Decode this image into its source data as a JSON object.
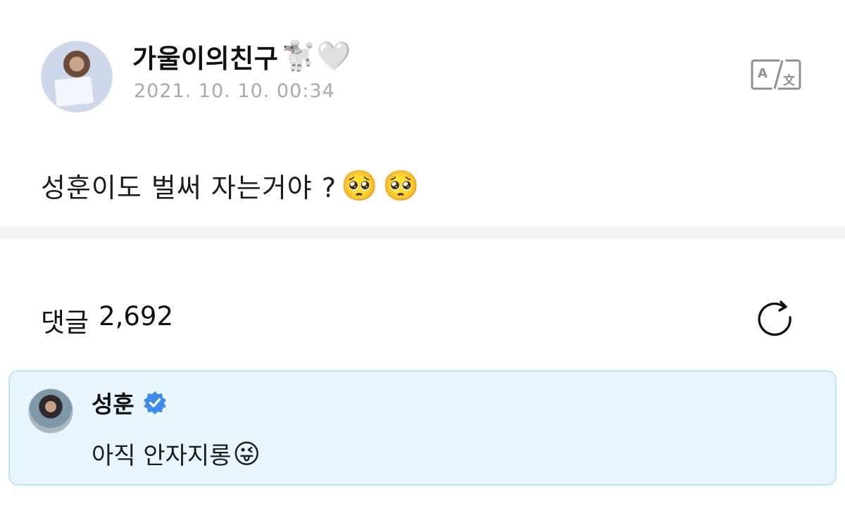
{
  "post": {
    "author_name": "가울이의친구",
    "author_emojis": "🐩🤍",
    "timestamp": "2021. 10. 10. 00:34",
    "body_text": "성훈이도 벌써 자는거야 ?",
    "body_emojis": [
      "🥺",
      "🥺"
    ],
    "translate_icon": "translate-icon"
  },
  "comments": {
    "label": "댓글",
    "count": "2,692",
    "refresh_icon": "refresh-icon"
  },
  "highlighted_comment": {
    "author": "성훈",
    "verified_icon": "verified-badge-icon",
    "text": "아직 안자지롱",
    "emoji": "😜",
    "colors": {
      "background": "#e9f6fd",
      "border": "#bfe3f5",
      "verified": "#3b8ced"
    }
  }
}
